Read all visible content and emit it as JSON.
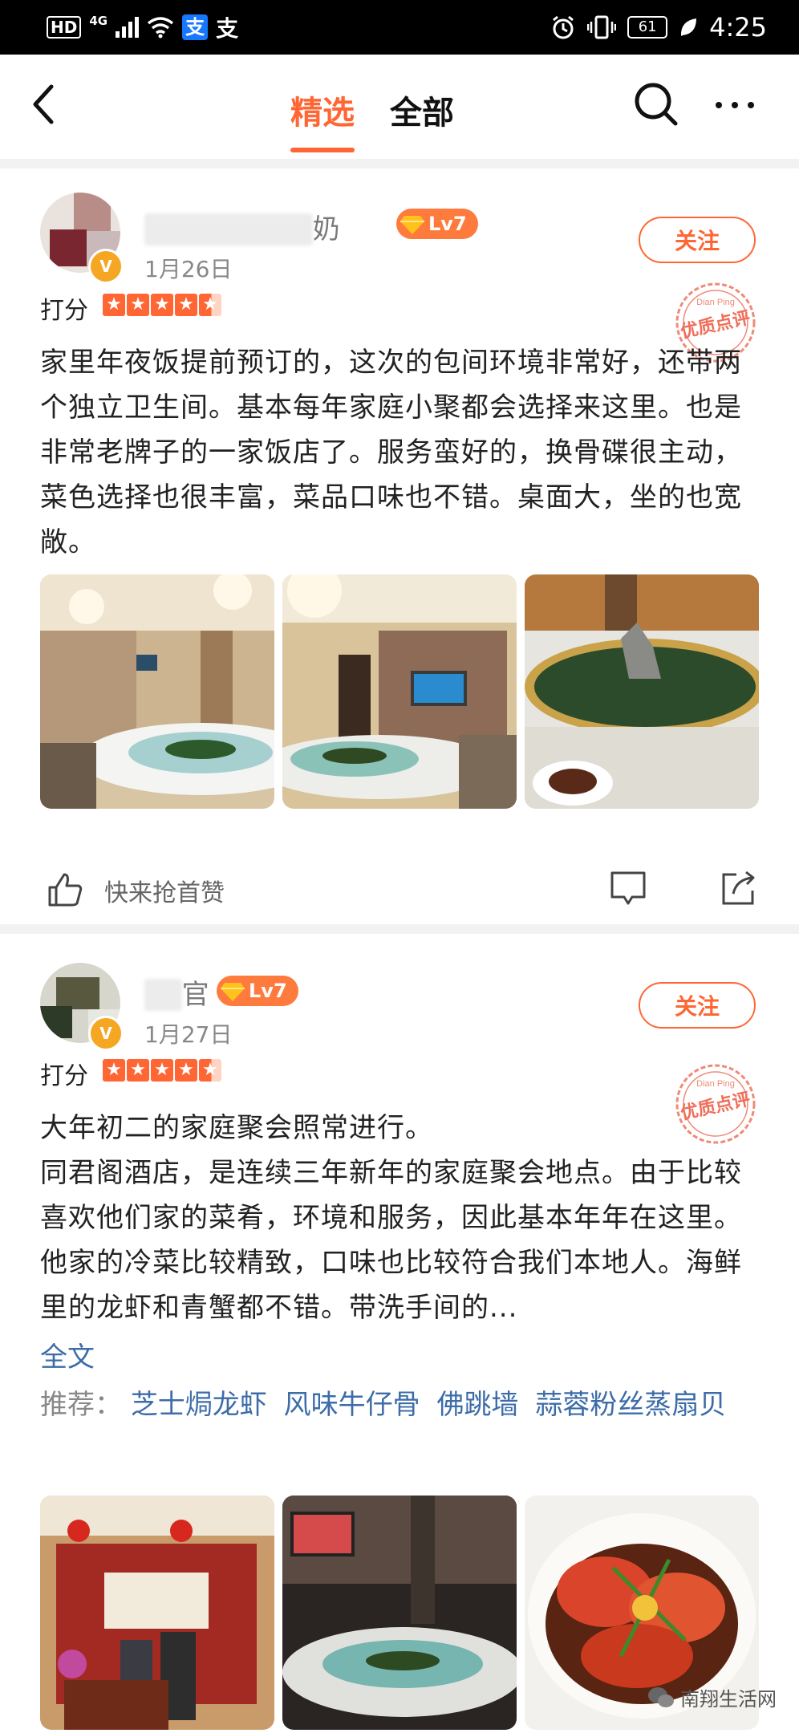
{
  "status_bar": {
    "hd": "HD",
    "network": "4G",
    "alipay": "支",
    "alipay2": "支",
    "battery": "61",
    "time": "4:25"
  },
  "nav": {
    "tab_selected": "精选",
    "tab_all": "全部",
    "accent_color": "#ff6633"
  },
  "reviews": [
    {
      "username_visible": "奶",
      "level": "Lv7",
      "date": "1月26日",
      "follow_label": "关注",
      "rating_label": "打分",
      "stars": 4.5,
      "stamp_text": "优质点评",
      "stamp_pinyin": "Dian Ping",
      "text": "家里年夜饭提前预订的，这次的包间环境非常好，还带两个独立卫生间。基本每年家庭小聚都会选择来这里。也是非常老牌子的一家饭店了。服务蛮好的，换骨碟很主动，菜色选择也很丰富，菜品口味也不错。桌面大，坐的也宽敞。",
      "like_label": "快来抢首赞"
    },
    {
      "username_visible": "官",
      "level": "Lv7",
      "date": "1月27日",
      "follow_label": "关注",
      "rating_label": "打分",
      "stars": 4.5,
      "stamp_text": "优质点评",
      "stamp_pinyin": "Dian Ping",
      "text": "大年初二的家庭聚会照常进行。\n同君阁酒店，是连续三年新年的家庭聚会地点。由于比较喜欢他们家的菜肴，环境和服务，因此基本年年在这里。他家的冷菜比较精致，口味也比较符合我们本地人。海鲜里的龙虾和青蟹都不错。带洗手间的...",
      "full_text_link": "全文",
      "recommend_label": "推荐：",
      "recommend_dishes": [
        "芝士焗龙虾",
        "风味牛仔骨",
        "佛跳墙",
        "蒜蓉粉丝蒸扇贝"
      ]
    }
  ],
  "watermark": "南翔生活网"
}
